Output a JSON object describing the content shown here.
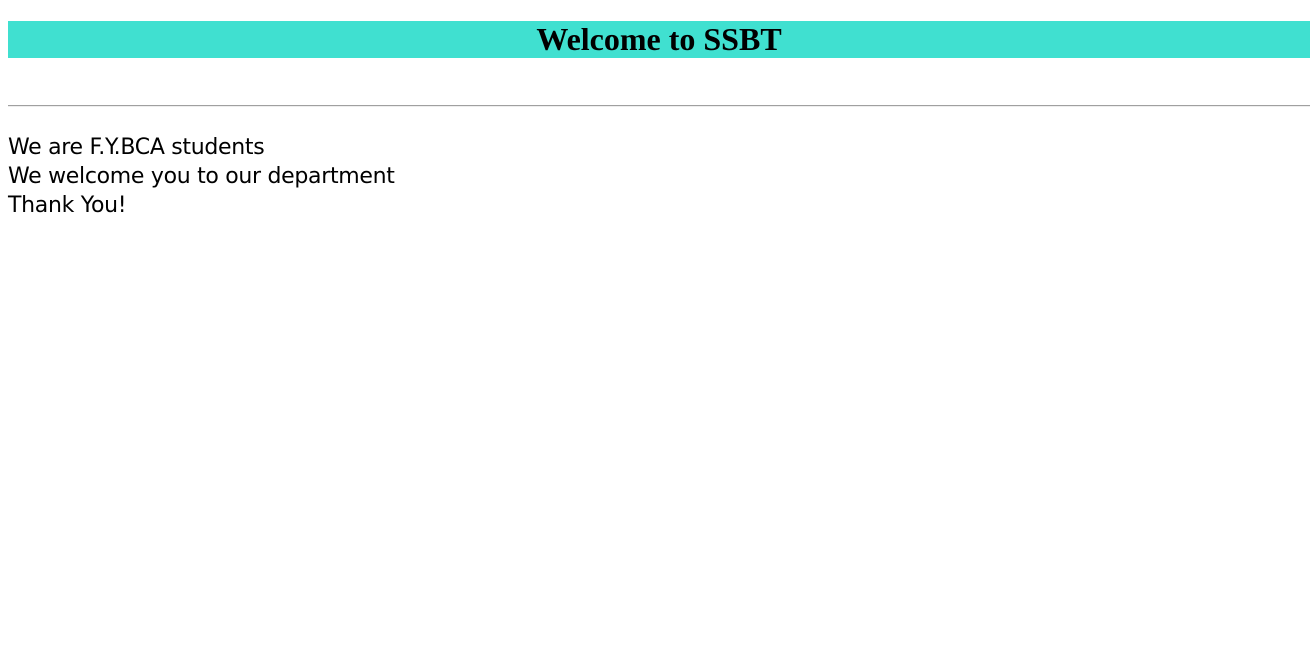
{
  "banner": {
    "title": "Welcome to SSBT",
    "background_color": "#40e0d0"
  },
  "content": {
    "lines": [
      "We are F.Y.BCA students",
      "We welcome you to our department",
      "Thank You!"
    ]
  }
}
